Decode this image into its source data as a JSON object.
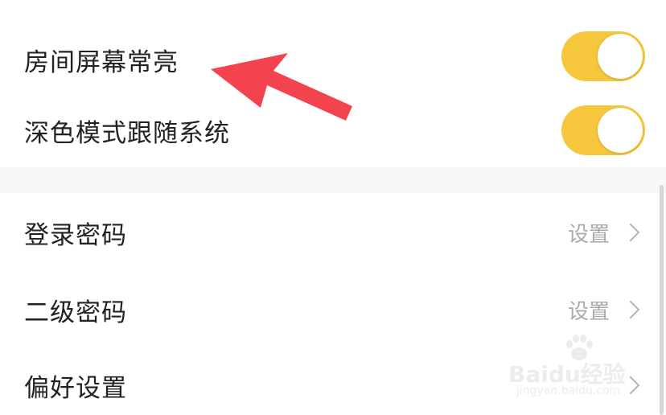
{
  "settings": {
    "toggles": [
      {
        "label": "房间屏幕常亮",
        "on": true
      },
      {
        "label": "深色模式跟随系统",
        "on": true
      }
    ],
    "links": [
      {
        "label": "登录密码",
        "value": "设置"
      },
      {
        "label": "二级密码",
        "value": "设置"
      },
      {
        "label": "偏好设置",
        "value": ""
      }
    ]
  },
  "watermark": {
    "brand": "Baidu经验",
    "url": "jingyan.baidu.com"
  },
  "colors": {
    "toggle_on": "#f6c73c",
    "annotation_arrow": "#f2434e",
    "value_text": "#aaaaaa"
  }
}
